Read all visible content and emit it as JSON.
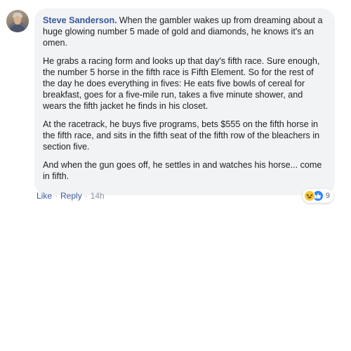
{
  "comment": {
    "author": "Steve Sanderson.",
    "paragraphs": [
      "When the gambler wakes up from dreaming about a huge glowing number 5 made of gold and diamonds, he knows it's an omen.",
      "He grabs a racing form and looks up that day's fifth race. Sure enough, the number 5 horse in the fifth race is Fifth Element. So for the rest of the day he does everything in fives: He eats five bowls of cereal for breakfast, goes for a five-mile run, takes a five minute shower, and wears the fifth jacket he finds in his closet.",
      "At the racetrack, he buys five programs, bets $555 on the fifth horse in the fifth race, and sits in the fifth seat of the fifth row of the bleachers in section five.",
      "And when the gun goes off, he settles in and watches his horse... come in fifth."
    ],
    "reactions": {
      "icons": [
        "haha-icon",
        "like-icon"
      ],
      "count": "9"
    }
  },
  "actions": {
    "like_label": "Like",
    "reply_label": "Reply",
    "separator": "·",
    "timestamp": "14h"
  },
  "colors": {
    "author_link": "#385898",
    "bubble_bg": "#f2f3f5",
    "meta_gray": "#90949c",
    "like_blue": "#2d88ff",
    "haha_yellow": "#f7c93a"
  }
}
